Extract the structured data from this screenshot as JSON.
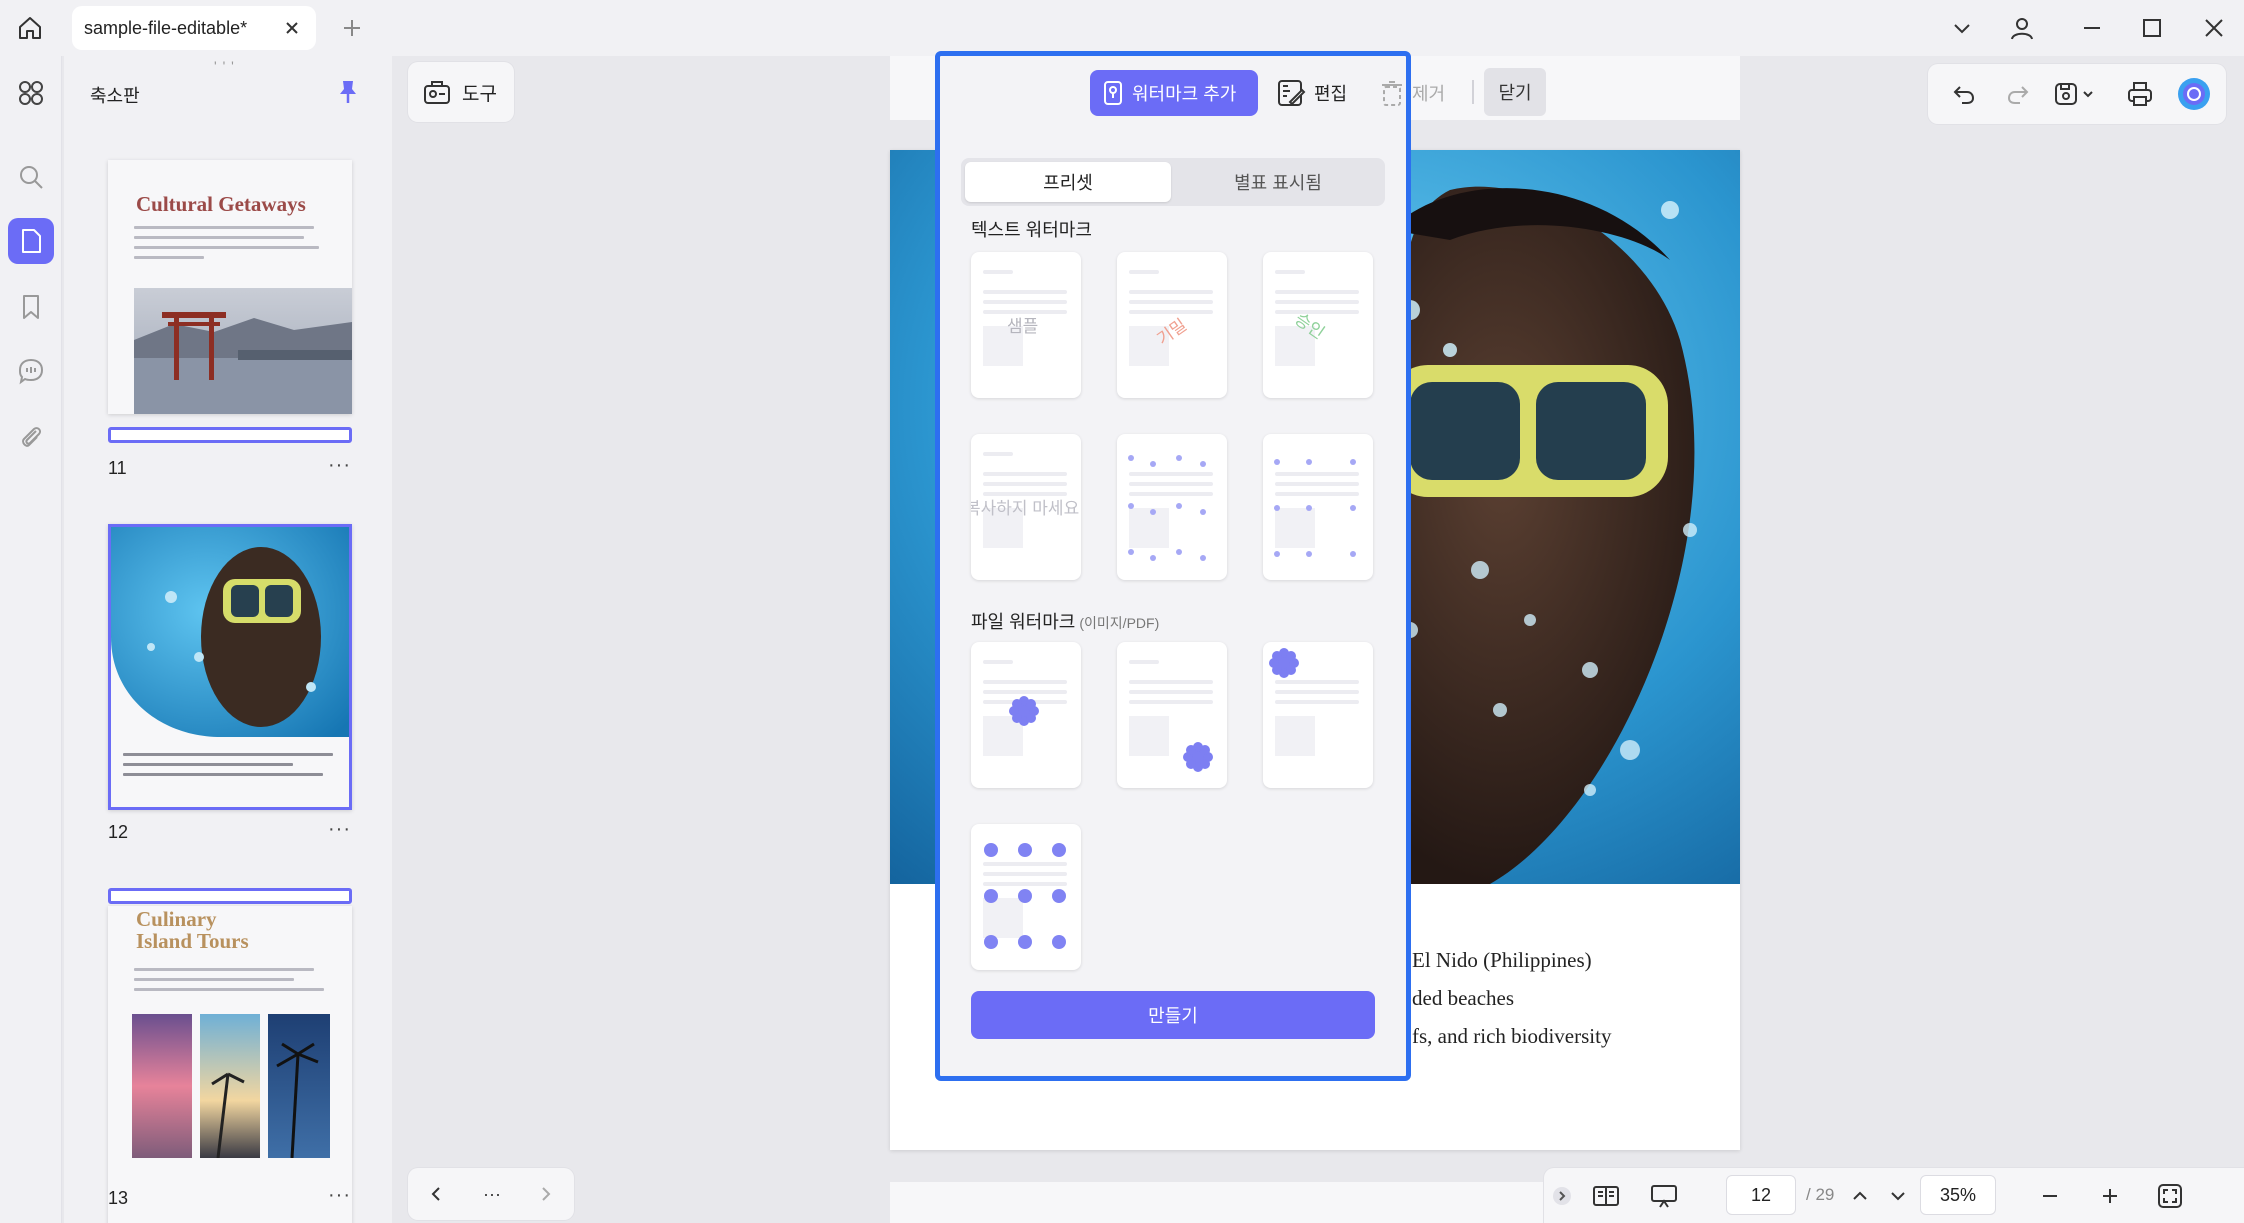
{
  "titlebar": {
    "tab_title": "sample-file-editable*"
  },
  "thumbnails": {
    "panel_title": "축소판",
    "pages": [
      {
        "number": "11",
        "heading": "Cultural Getaways"
      },
      {
        "number": "12",
        "heading": ""
      },
      {
        "number": "13",
        "heading": "Culinary Island Tours"
      }
    ],
    "more_label": "···"
  },
  "toolbar": {
    "tools_label": "도구"
  },
  "watermark": {
    "add_label": "워터마크 추가",
    "edit_label": "편집",
    "remove_label": "제거",
    "close_label": "닫기",
    "tabs": [
      "프리셋",
      "별표 표시됨"
    ],
    "active_tab": "프리셋",
    "text_section": "텍스트 워터마크",
    "file_section": "파일 워터마크",
    "file_section_sub": "(이미지/PDF)",
    "preset_texts": [
      "샘플",
      "기밀",
      "승인",
      "복사하지 마세요"
    ],
    "create_label": "만들기"
  },
  "document": {
    "lines": [
      "El Nido (Philippines)",
      "ded beaches",
      "fs, and rich biodiversity"
    ]
  },
  "statusbar": {
    "current_page": "12",
    "total_pages": "/ 29",
    "zoom": "35%"
  },
  "colors": {
    "accent": "#6b6cf6",
    "panel_border": "#2d6ff0"
  }
}
